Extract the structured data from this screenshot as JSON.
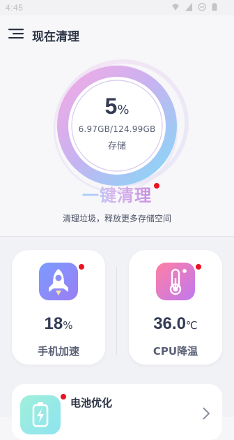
{
  "status_bar": {
    "time": "4:45"
  },
  "header": {
    "title": "现在清理"
  },
  "storage": {
    "percent": "5",
    "percent_symbol": "%",
    "usage": "6.97GB/124.99GB",
    "label": "存储",
    "used_fraction": 0.05
  },
  "clean": {
    "button_label": "一键清理",
    "subtitle": "清理垃圾，释放更多存储空间"
  },
  "cards": {
    "boost": {
      "value": "18",
      "unit": "%",
      "label": "手机加速"
    },
    "cool": {
      "value": "36.0",
      "unit": "℃",
      "label": "CPU降温"
    }
  },
  "battery": {
    "title": "电池优化"
  },
  "colors": {
    "accent_red": "#ea1320",
    "ring_gradient_start": "#f7a9e3",
    "ring_gradient_end": "#7fdbf8",
    "text_dark": "#343c55"
  },
  "icons": [
    "menu-icon",
    "rocket-icon",
    "thermometer-icon",
    "battery-icon",
    "chevron-right-icon"
  ]
}
